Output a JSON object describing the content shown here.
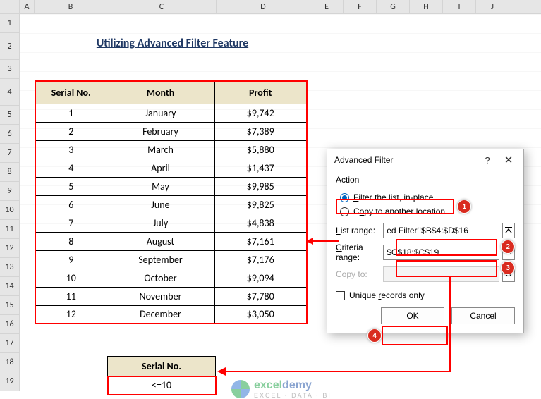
{
  "columns": [
    "A",
    "B",
    "C",
    "D",
    "E",
    "F",
    "G",
    "H",
    "I",
    "J"
  ],
  "rows": [
    "1",
    "2",
    "3",
    "4",
    "5",
    "6",
    "7",
    "8",
    "9",
    "10",
    "11",
    "12",
    "13",
    "14",
    "15",
    "16",
    "17",
    "18",
    "19"
  ],
  "title": "Utilizing Advanced Filter Feature",
  "table": {
    "headers": {
      "serial": "Serial No.",
      "month": "Month",
      "profit": "Profit"
    },
    "rows": [
      {
        "serial": "1",
        "month": "January",
        "profit": "$9,742"
      },
      {
        "serial": "2",
        "month": "February",
        "profit": "$7,389"
      },
      {
        "serial": "3",
        "month": "March",
        "profit": "$5,880"
      },
      {
        "serial": "4",
        "month": "April",
        "profit": "$1,437"
      },
      {
        "serial": "5",
        "month": "May",
        "profit": "$9,985"
      },
      {
        "serial": "6",
        "month": "June",
        "profit": "$9,825"
      },
      {
        "serial": "7",
        "month": "July",
        "profit": "$4,838"
      },
      {
        "serial": "8",
        "month": "August",
        "profit": "$7,161"
      },
      {
        "serial": "9",
        "month": "September",
        "profit": "$7,176"
      },
      {
        "serial": "10",
        "month": "October",
        "profit": "$9,094"
      },
      {
        "serial": "11",
        "month": "November",
        "profit": "$7,780"
      },
      {
        "serial": "12",
        "month": "December",
        "profit": "$3,050"
      }
    ]
  },
  "criteria": {
    "header": "Serial No.",
    "value": "<=10"
  },
  "dialog": {
    "title": "Advanced Filter",
    "action_label": "Action",
    "radio_inplace": "Filter the list, in-place",
    "radio_copy": "Copy to another location",
    "list_range_label": "List range:",
    "list_range_value": "ed Filter'!$B$4:$D$16",
    "criteria_range_label": "Criteria range:",
    "criteria_range_value": "$C$18:$C$19",
    "copy_to_label": "Copy to:",
    "copy_to_value": "",
    "unique_label": "Unique records only",
    "ok": "OK",
    "cancel": "Cancel"
  },
  "badges": {
    "b1": "1",
    "b2": "2",
    "b3": "3",
    "b4": "4"
  },
  "watermark": {
    "brand_a": "excel",
    "brand_b": "demy",
    "sub": "EXCEL · DATA · BI"
  },
  "chart_data": {
    "type": "table",
    "title": "Utilizing Advanced Filter Feature",
    "columns": [
      "Serial No.",
      "Month",
      "Profit"
    ],
    "rows": [
      [
        1,
        "January",
        9742
      ],
      [
        2,
        "February",
        7389
      ],
      [
        3,
        "March",
        5880
      ],
      [
        4,
        "April",
        1437
      ],
      [
        5,
        "May",
        9985
      ],
      [
        6,
        "June",
        9825
      ],
      [
        7,
        "July",
        4838
      ],
      [
        8,
        "August",
        7161
      ],
      [
        9,
        "September",
        7176
      ],
      [
        10,
        "October",
        9094
      ],
      [
        11,
        "November",
        7780
      ],
      [
        12,
        "December",
        3050
      ]
    ],
    "criteria": {
      "field": "Serial No.",
      "condition": "<=10"
    },
    "advanced_filter": {
      "action": "in-place",
      "list_range": "'…ed Filter'!$B$4:$D$16",
      "criteria_range": "$C$18:$C$19",
      "unique_records_only": false
    }
  }
}
